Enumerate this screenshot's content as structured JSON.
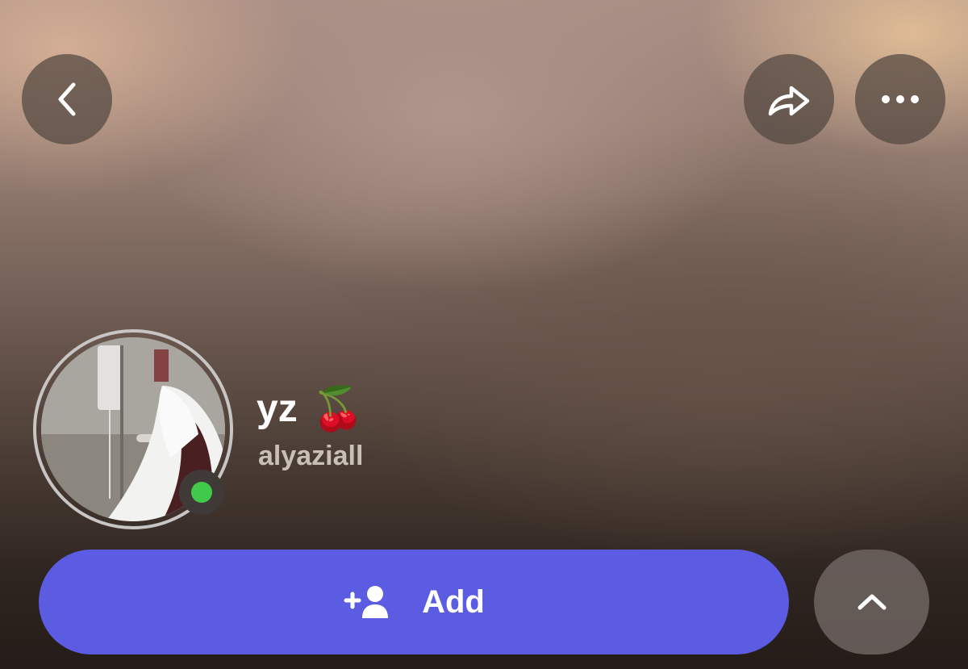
{
  "profile": {
    "display_name": "yz",
    "name_emoji": "🍒",
    "username": "alyaziall",
    "online": true
  },
  "actions": {
    "add_label": "Add"
  },
  "icons": {
    "back": "chevron-left-icon",
    "share": "share-arrow-icon",
    "more": "more-dots-icon",
    "add_friend": "add-friend-icon",
    "expand": "chevron-up-icon"
  },
  "colors": {
    "add_button": "#5b5ce2",
    "online_indicator": "#41c94a"
  }
}
